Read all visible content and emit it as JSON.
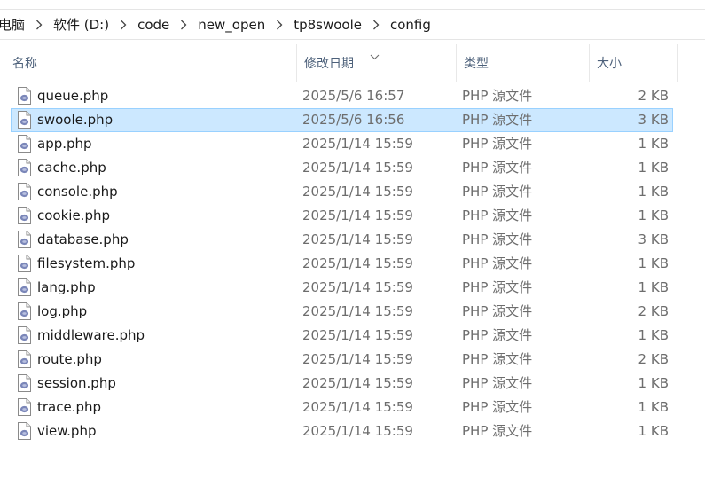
{
  "breadcrumb": {
    "items": [
      "电脑",
      "软件 (D:)",
      "code",
      "new_open",
      "tp8swoole",
      "config"
    ]
  },
  "columns": {
    "name": "名称",
    "date": "修改日期",
    "type": "类型",
    "size": "大小"
  },
  "colors": {
    "selection_bg": "#cce8ff",
    "selection_border": "#99d1ff",
    "header_text": "#4c607a",
    "meta_text": "#6d6d6d",
    "php_icon": "#7a86b8"
  },
  "icons": {
    "file": "php-file-icon",
    "separator": "chevron-right-icon",
    "sort": "chevron-down-icon"
  },
  "files": [
    {
      "name": "queue.php",
      "date": "2025/5/6 16:57",
      "type": "PHP 源文件",
      "size": "2 KB",
      "selected": false
    },
    {
      "name": "swoole.php",
      "date": "2025/5/6 16:56",
      "type": "PHP 源文件",
      "size": "3 KB",
      "selected": true
    },
    {
      "name": "app.php",
      "date": "2025/1/14 15:59",
      "type": "PHP 源文件",
      "size": "1 KB",
      "selected": false
    },
    {
      "name": "cache.php",
      "date": "2025/1/14 15:59",
      "type": "PHP 源文件",
      "size": "1 KB",
      "selected": false
    },
    {
      "name": "console.php",
      "date": "2025/1/14 15:59",
      "type": "PHP 源文件",
      "size": "1 KB",
      "selected": false
    },
    {
      "name": "cookie.php",
      "date": "2025/1/14 15:59",
      "type": "PHP 源文件",
      "size": "1 KB",
      "selected": false
    },
    {
      "name": "database.php",
      "date": "2025/1/14 15:59",
      "type": "PHP 源文件",
      "size": "3 KB",
      "selected": false
    },
    {
      "name": "filesystem.php",
      "date": "2025/1/14 15:59",
      "type": "PHP 源文件",
      "size": "1 KB",
      "selected": false
    },
    {
      "name": "lang.php",
      "date": "2025/1/14 15:59",
      "type": "PHP 源文件",
      "size": "1 KB",
      "selected": false
    },
    {
      "name": "log.php",
      "date": "2025/1/14 15:59",
      "type": "PHP 源文件",
      "size": "2 KB",
      "selected": false
    },
    {
      "name": "middleware.php",
      "date": "2025/1/14 15:59",
      "type": "PHP 源文件",
      "size": "1 KB",
      "selected": false
    },
    {
      "name": "route.php",
      "date": "2025/1/14 15:59",
      "type": "PHP 源文件",
      "size": "2 KB",
      "selected": false
    },
    {
      "name": "session.php",
      "date": "2025/1/14 15:59",
      "type": "PHP 源文件",
      "size": "1 KB",
      "selected": false
    },
    {
      "name": "trace.php",
      "date": "2025/1/14 15:59",
      "type": "PHP 源文件",
      "size": "1 KB",
      "selected": false
    },
    {
      "name": "view.php",
      "date": "2025/1/14 15:59",
      "type": "PHP 源文件",
      "size": "1 KB",
      "selected": false
    }
  ]
}
